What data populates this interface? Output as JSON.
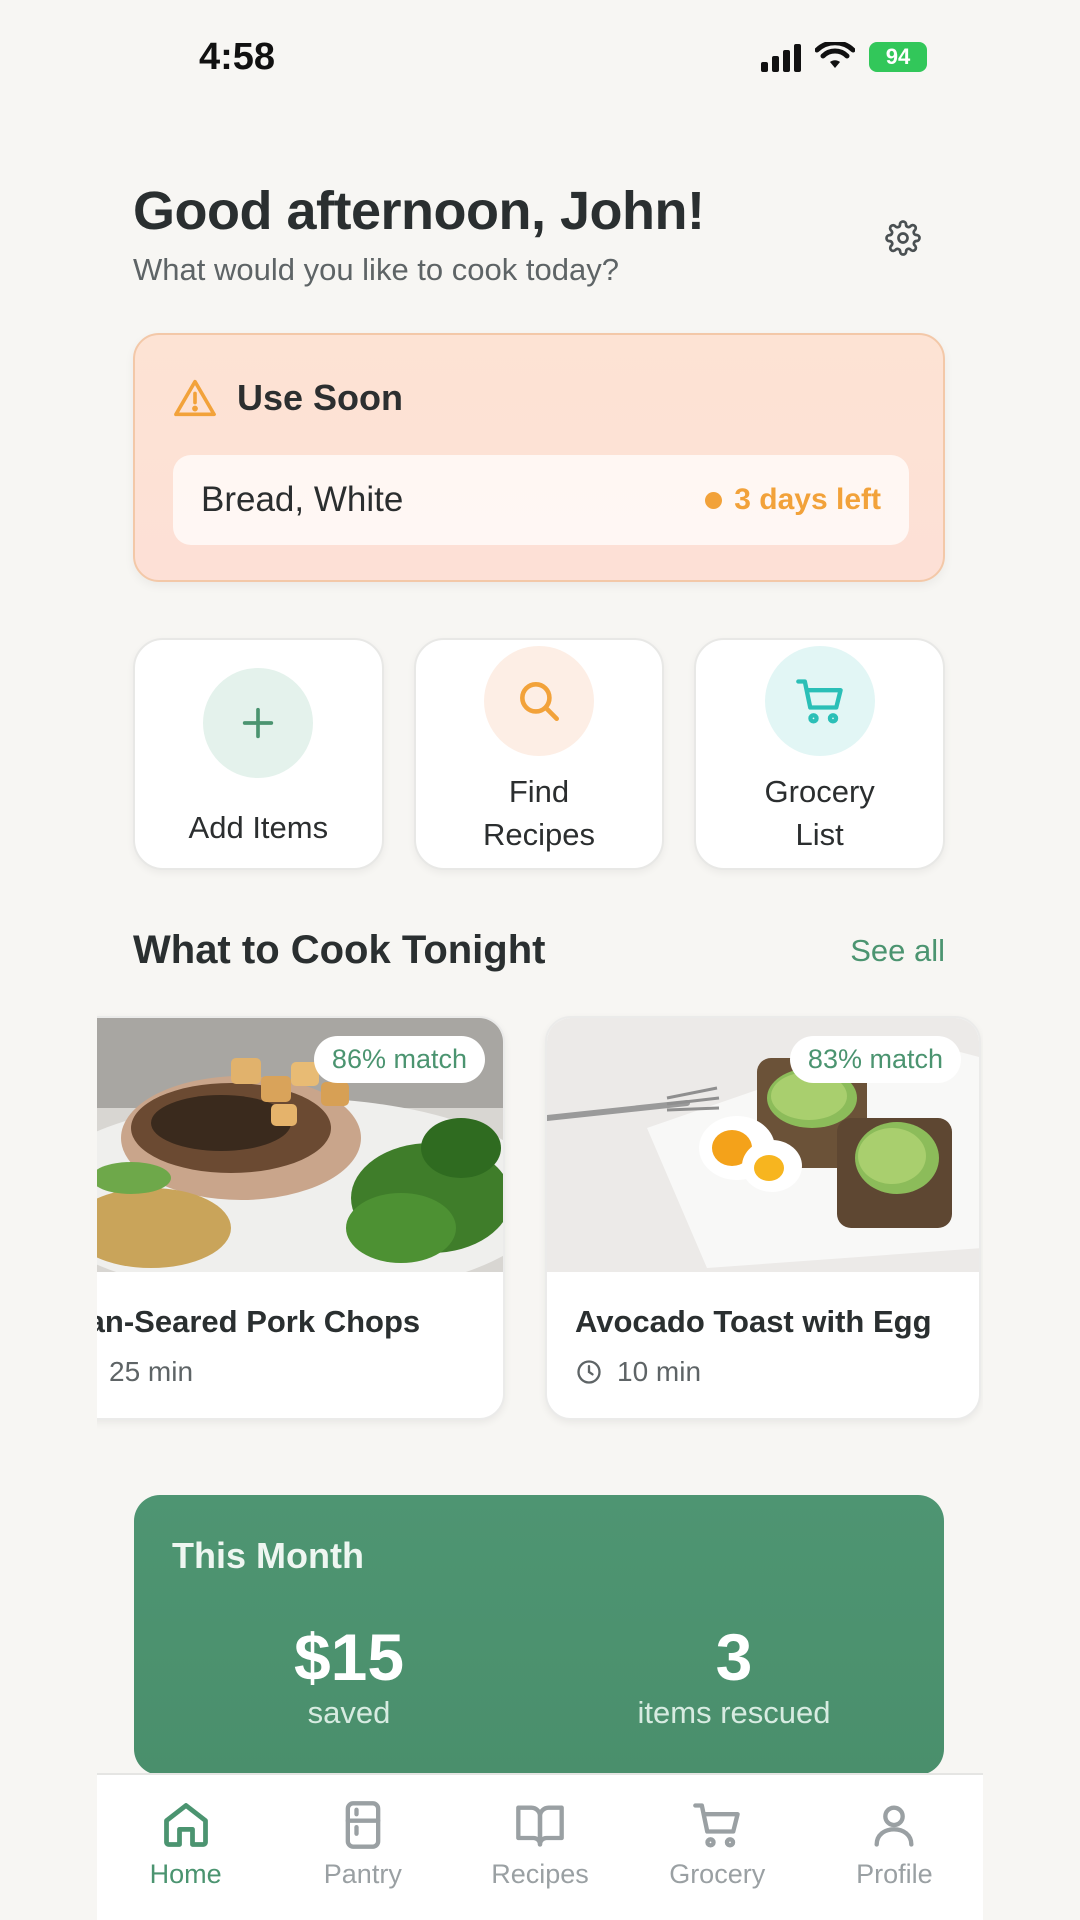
{
  "status_bar": {
    "time": "4:58",
    "battery": "94"
  },
  "greeting": {
    "title": "Good afternoon, John!",
    "subtitle": "What would you like to cook today?"
  },
  "use_soon": {
    "title": "Use Soon",
    "item": {
      "name": "Bread, White",
      "status": "3 days left"
    }
  },
  "actions": [
    {
      "label": "Add Items"
    },
    {
      "label": "Find Recipes"
    },
    {
      "label": "Grocery List"
    }
  ],
  "section": {
    "title": "What to Cook Tonight",
    "see_all": "See all"
  },
  "recipes": [
    {
      "match": "86% match",
      "title": "Pan-Seared Pork Chops",
      "time": "25 min"
    },
    {
      "match": "83% match",
      "title": "Avocado Toast with Egg",
      "time": "10 min"
    }
  ],
  "month": {
    "title": "This Month",
    "saved_value": "$15",
    "saved_label": "saved",
    "rescued_value": "3",
    "rescued_label": "items rescued"
  },
  "nav": [
    {
      "label": "Home",
      "icon": "home-icon",
      "active": true
    },
    {
      "label": "Pantry",
      "icon": "fridge-icon"
    },
    {
      "label": "Recipes",
      "icon": "book-icon"
    },
    {
      "label": "Grocery",
      "icon": "cart-icon"
    },
    {
      "label": "Profile",
      "icon": "user-icon"
    }
  ],
  "colors": {
    "accent": "#4b9470",
    "warning": "#f2a23a",
    "card_bg": "#ffffff"
  }
}
